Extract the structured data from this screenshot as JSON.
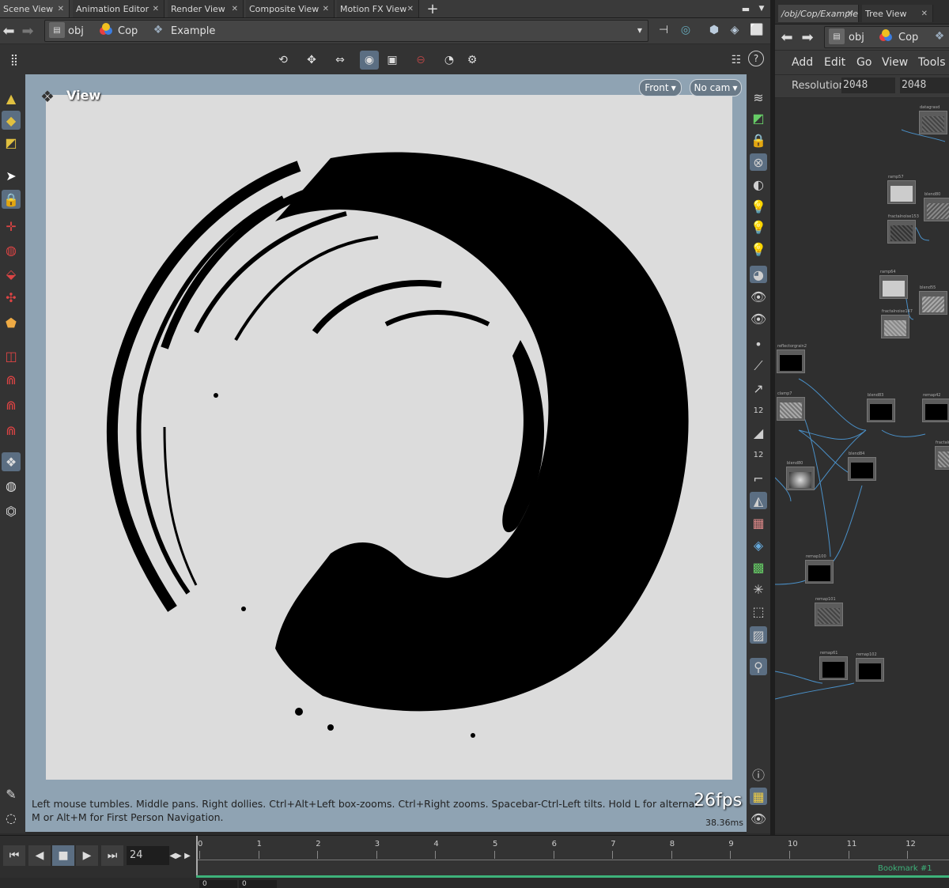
{
  "left_tabs": [
    "Scene View",
    "Animation Editor",
    "Render View",
    "Composite View",
    "Motion FX View"
  ],
  "left_path": {
    "root": "obj",
    "context": "Cop",
    "network": "Example"
  },
  "viewport": {
    "title": "View",
    "view_menu": "Front",
    "cam_menu": "No cam",
    "help_line1": "Left mouse tumbles. Middle pans. Right dollies. Ctrl+Alt+Left box-zooms. Ctrl+Right zooms. Spacebar-Ctrl-Left tilts. Hold L for alternate tumble, dolly, a",
    "help_line2": "M or Alt+M for First Person Navigation.",
    "fps": "26fps",
    "ms": "38.36ms"
  },
  "right_tabs": [
    "/obj/Cop/Example",
    "Tree View"
  ],
  "right_path": {
    "root": "obj",
    "context": "Cop"
  },
  "network_menu": [
    "Add",
    "Edit",
    "Go",
    "View",
    "Tools"
  ],
  "resolution": {
    "label": "Resolution",
    "x": "2048",
    "y": "2048"
  },
  "nodes": [
    {
      "label": "datagrasd",
      "kind": "noise"
    },
    {
      "label": "ramp57",
      "kind": "light"
    },
    {
      "label": "blend80",
      "kind": "noise"
    },
    {
      "label": "fractalnoise153",
      "kind": "noise"
    },
    {
      "label": "ramp64",
      "kind": "light"
    },
    {
      "label": "blend55",
      "kind": "noise"
    },
    {
      "label": "fractalnoise147",
      "kind": "noise"
    },
    {
      "label": "reflectorgrain2",
      "kind": "dark"
    },
    {
      "label": "clamp7",
      "kind": "noise"
    },
    {
      "label": "blend83",
      "kind": "dark"
    },
    {
      "label": "remap42",
      "kind": "dark"
    },
    {
      "label": "fractalnoise",
      "kind": "noise"
    },
    {
      "label": "blend84",
      "kind": "dark"
    },
    {
      "label": "blend80",
      "kind": "gradient"
    },
    {
      "label": "remap100",
      "kind": "dark"
    },
    {
      "label": "remap101",
      "kind": "noise"
    },
    {
      "label": "remap61",
      "kind": "dark"
    },
    {
      "label": "remap102",
      "kind": "dark"
    }
  ],
  "playbar": {
    "frame": "24",
    "ticks": [
      "0",
      "1",
      "2",
      "3",
      "4",
      "5",
      "6",
      "7",
      "8",
      "9",
      "10",
      "11",
      "12"
    ],
    "bookmark": "Bookmark #1",
    "start": "0",
    "end": "0"
  },
  "colors": {
    "accent": "#5b6e82",
    "wire": "#4a90c8",
    "bookmark": "#3db27a",
    "viewport_bg": "#dcdcdc",
    "frame_bg": "#8fa3b3"
  }
}
